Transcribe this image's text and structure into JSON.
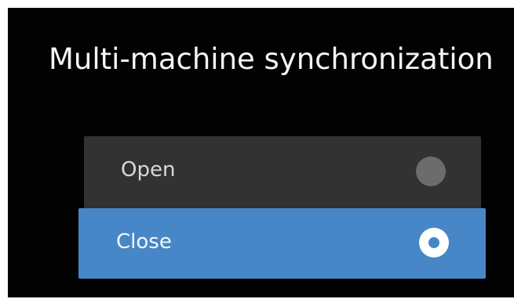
{
  "dialog": {
    "title": "Multi-machine synchronization",
    "options": [
      {
        "label": "Open",
        "selected": false
      },
      {
        "label": "Close",
        "selected": true
      }
    ]
  },
  "colors": {
    "background": "#020202",
    "option_bg": "#323232",
    "selected_bg": "#4787c7",
    "radio_off": "#6c6c6c",
    "radio_on": "#ffffff",
    "text": "#f5f5f5"
  }
}
